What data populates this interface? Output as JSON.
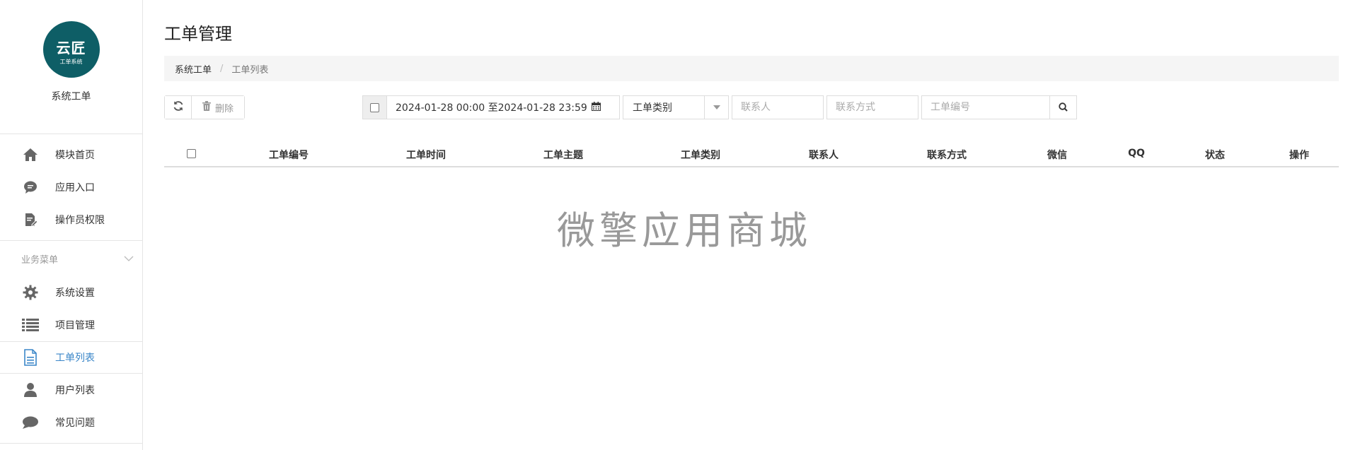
{
  "sidebar": {
    "logo": {
      "main": "云匠",
      "sub": "工单系统",
      "color": "#0e5e66"
    },
    "app_name": "系统工单",
    "top_items": [
      {
        "label": "模块首页",
        "icon": "home-icon"
      },
      {
        "label": "应用入口",
        "icon": "chat-bubble-icon"
      },
      {
        "label": "操作员权限",
        "icon": "file-edit-icon"
      }
    ],
    "group": {
      "title": "业务菜单",
      "icon": "chevron-down-icon",
      "items": [
        {
          "label": "系统设置",
          "icon": "gear-icon"
        },
        {
          "label": "项目管理",
          "icon": "list-icon"
        },
        {
          "label": "工单列表",
          "icon": "document-icon",
          "active": true
        },
        {
          "label": "用户列表",
          "icon": "user-icon"
        },
        {
          "label": "常见问题",
          "icon": "comment-icon"
        }
      ]
    },
    "active_color": "#3a86c8"
  },
  "main": {
    "title": "工单管理",
    "breadcrumb": {
      "parent": "系统工单",
      "separator": "/",
      "current": "工单列表"
    },
    "toolbar": {
      "refresh_icon": "refresh-icon",
      "delete_label": "删除",
      "delete_icon": "trash-icon"
    },
    "filters": {
      "date_range": "2024-01-28 00:00 至2024-01-28 23:59",
      "calendar_icon": "calendar-icon",
      "category_select": "工单类别",
      "contact_placeholder": "联系人",
      "contact_method_placeholder": "联系方式",
      "ticket_no_placeholder": "工单编号",
      "search_icon": "search-icon"
    },
    "table": {
      "columns": [
        "工单编号",
        "工单时间",
        "工单主题",
        "工单类别",
        "联系人",
        "联系方式",
        "微信",
        "QQ",
        "状态",
        "操作"
      ],
      "rows": []
    },
    "watermark": "微擎应用商城"
  }
}
